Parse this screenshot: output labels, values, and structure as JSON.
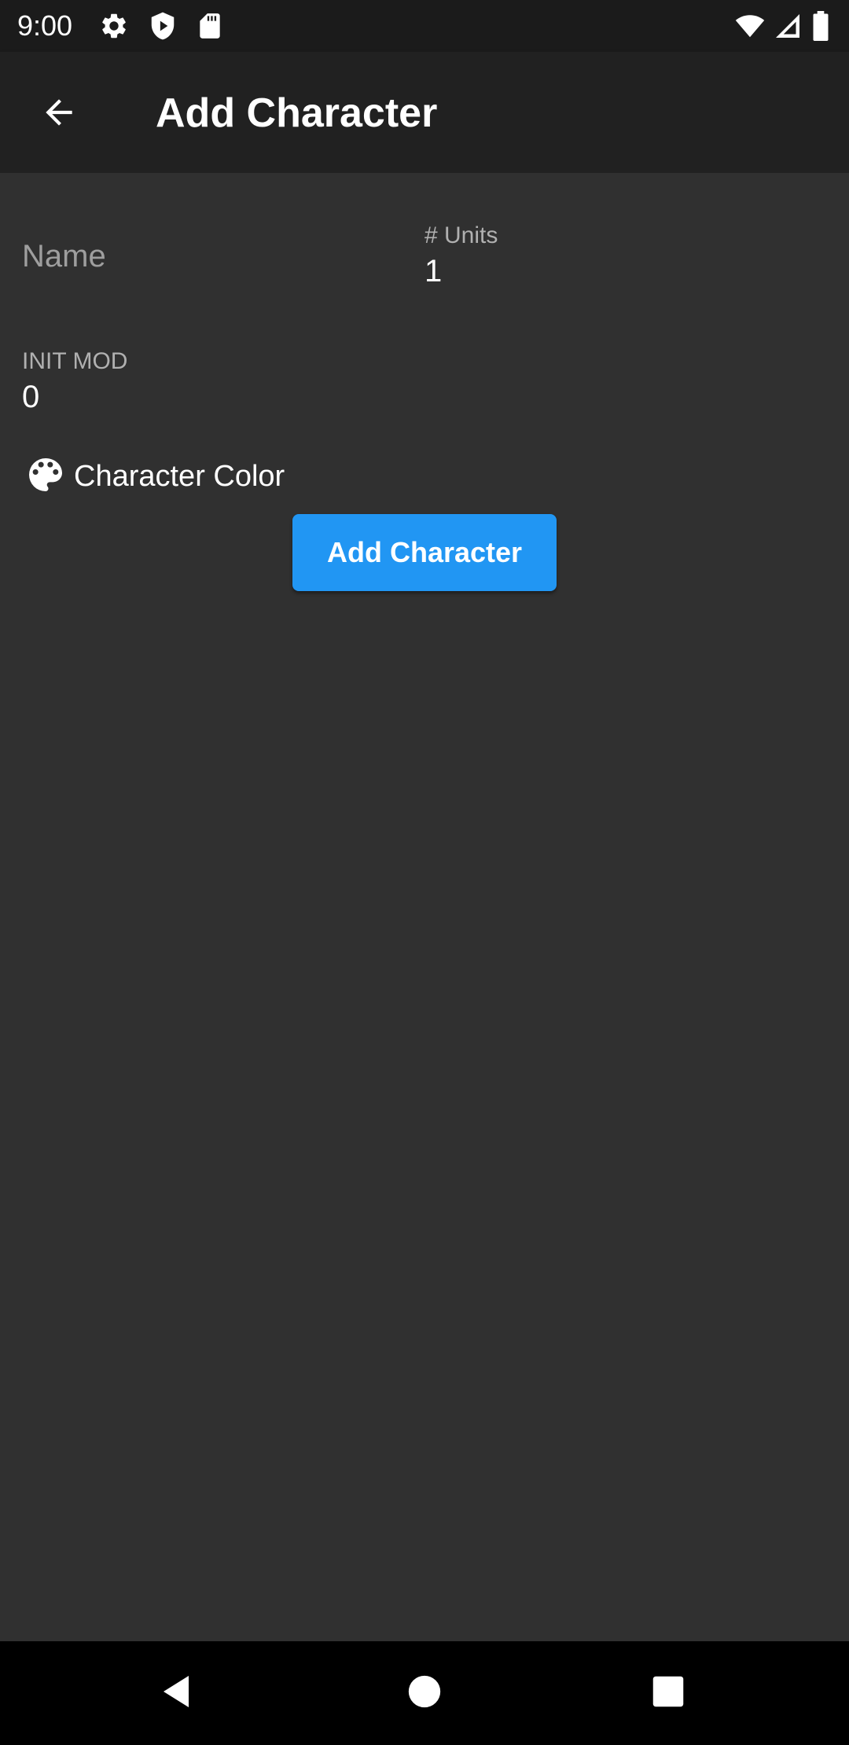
{
  "status_bar": {
    "time": "9:00",
    "left_icons": [
      "settings-icon",
      "shield-play-icon",
      "sd-card-icon"
    ],
    "right_icons": [
      "wifi-icon",
      "cell-signal-icon",
      "battery-icon"
    ]
  },
  "app_bar": {
    "title": "Add Character",
    "back_icon": "arrow-back-icon"
  },
  "form": {
    "name": {
      "placeholder": "Name",
      "value": ""
    },
    "units": {
      "label": "# Units",
      "value": "1"
    },
    "init_mod": {
      "label": "INIT MOD",
      "value": "0"
    },
    "character_color": {
      "label": "Character Color",
      "icon": "palette-icon"
    },
    "submit_label": "Add Character"
  },
  "nav_bar": {
    "buttons": [
      "back-triangle-icon",
      "home-circle-icon",
      "recents-square-icon"
    ]
  },
  "colors": {
    "background": "#303030",
    "app_bar": "#212121",
    "accent": "#2196f3"
  }
}
